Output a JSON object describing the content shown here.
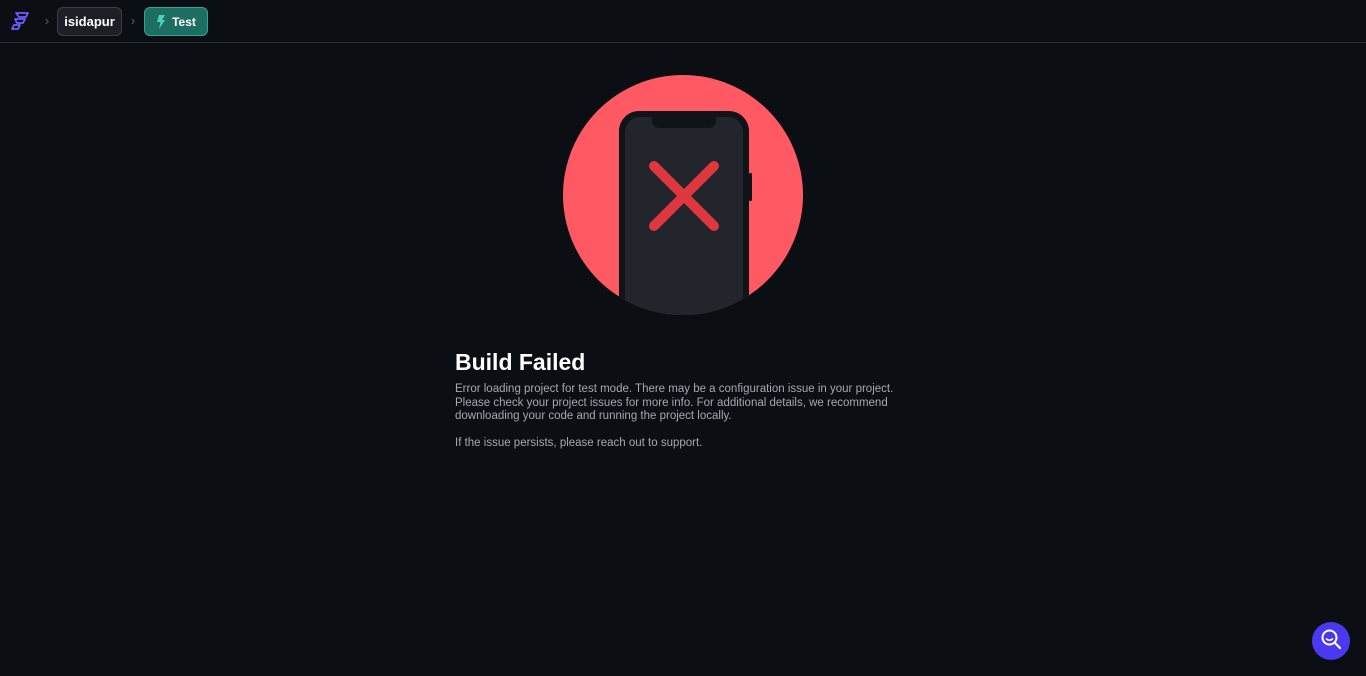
{
  "header": {
    "logo_icon": "flutterflow-logo-icon",
    "separator_icon": "chevron-right-icon",
    "project_name": "isidapur",
    "mode": {
      "icon": "bolt-icon",
      "label": "Test"
    }
  },
  "main": {
    "illustration_icon": "phone-error-icon",
    "title": "Build Failed",
    "description": "Error loading project for test mode. There may be a configuration issue in your project. Please check your project issues for more info. For additional details, we recommend downloading your code and running the project locally.",
    "support_text": "If the issue persists, please reach out to support."
  },
  "help_button": {
    "icon": "search-help-icon"
  },
  "colors": {
    "background": "#0b0f14",
    "accent": "#4b39ef",
    "mode_badge": "#1e6d63",
    "error_circle": "#ff5963",
    "error_cross": "#e0363e"
  }
}
